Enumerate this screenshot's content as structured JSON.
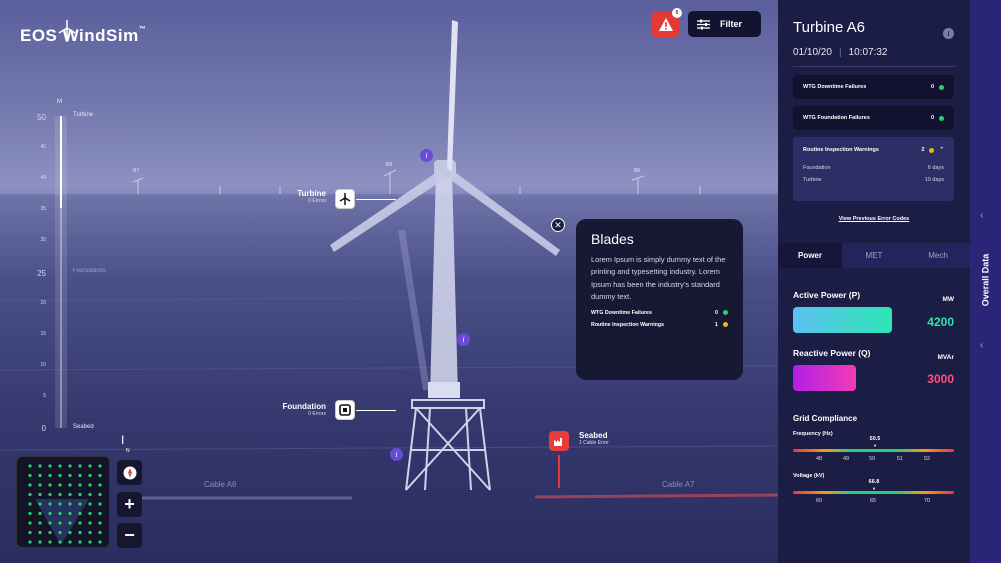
{
  "app": {
    "logo_text": "EOS WindSim",
    "logo_tm": "™"
  },
  "depth_gauge": {
    "unit": "M",
    "ticks": [
      "50",
      "45",
      "40",
      "35",
      "30",
      "25",
      "20",
      "15",
      "10",
      "5",
      "0"
    ],
    "top_label": "Turbine",
    "mid_label": "Foundations",
    "bottom_label": "Seabed"
  },
  "background_turbines": [
    "B7",
    "B8",
    "B6"
  ],
  "markers": {
    "turbine": {
      "title": "Turbine",
      "sub": "0 Errors",
      "icon": "turbine-icon"
    },
    "foundation": {
      "title": "Foundation",
      "sub": "0 Errors",
      "icon": "foundation-icon"
    },
    "seabed": {
      "title": "Seabed",
      "sub": "1 Cable Error",
      "icon": "factory-icon"
    }
  },
  "popup": {
    "title": "Blades",
    "body": "Lorem Ipsum is simply dummy text of the printing and typesetting industry. Lorem Ipsum has been the industry’s standard dummy text.",
    "rows": [
      {
        "label": "WTG Downtime Failures",
        "value": "0",
        "color": "#2ecc71"
      },
      {
        "label": "Routine Inspection Warnings",
        "value": "1",
        "color": "#f5b31b"
      }
    ]
  },
  "controls": {
    "alert_count": "0",
    "filter_label": "Filter",
    "zoom_in": "+",
    "zoom_out": "−",
    "compass_letter": "N"
  },
  "cables": {
    "left": "Cable A6",
    "right": "Cable A7"
  },
  "panel": {
    "title": "Turbine A6",
    "date": "01/10/20",
    "time": "10:07:32",
    "errors": [
      {
        "label": "WTG Downtime Failures",
        "value": "0",
        "color": "#2ecc71"
      },
      {
        "label": "WTG Foundation Failures",
        "value": "0",
        "color": "#2ecc71"
      }
    ],
    "warnings": {
      "label": "Routine Inspection Warnings",
      "value": "2",
      "color": "#f5b31b",
      "items": [
        {
          "name": "Foundation",
          "value": "6 days"
        },
        {
          "name": "Turbine",
          "value": "10 days"
        }
      ]
    },
    "prev_link": "View Previous Error Codes",
    "tabs": [
      "Power",
      "MET",
      "Mech"
    ],
    "active_power": {
      "label": "Active Power (P)",
      "unit": "MW",
      "value": "4200",
      "color": "#2ee6a6"
    },
    "reactive_power": {
      "label": "Reactive Power (Q)",
      "unit": "MVAr",
      "value": "3000",
      "color": "#ff4f7b"
    },
    "grid": {
      "title": "Grid Compliance",
      "frequency": {
        "label": "Frequency (Hz)",
        "current": "50.5",
        "ticks": [
          "48",
          "49",
          "50",
          "51",
          "52"
        ]
      },
      "voltage": {
        "label": "Voltage (kV)",
        "current": "66.8",
        "ticks": [
          "60",
          "65",
          "70"
        ]
      }
    }
  },
  "side": {
    "label": "Overall Data"
  }
}
